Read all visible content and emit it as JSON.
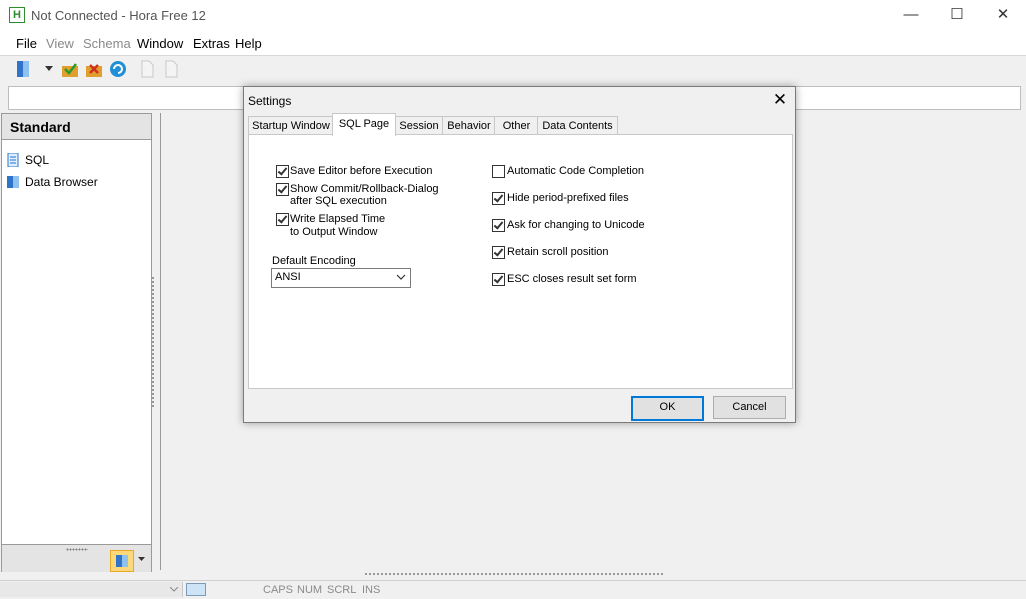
{
  "window": {
    "title": "Not Connected - Hora Free 12",
    "app_icon_letter": "H",
    "minimize": "—",
    "maximize": "☐",
    "close": "✕"
  },
  "menu": [
    "File",
    "View",
    "Schema",
    "Window",
    "Extras",
    "Help"
  ],
  "panel": {
    "title": "Standard",
    "items": [
      {
        "label": "SQL",
        "icon": "sql-page-icon"
      },
      {
        "label": "Data Browser",
        "icon": "data-browser-icon"
      }
    ]
  },
  "statusbar": [
    "CAPS",
    "NUM",
    "SCRL",
    "INS"
  ],
  "dialog": {
    "title": "Settings",
    "close": "✕",
    "tabs": [
      "Startup Window",
      "SQL Page",
      "Session",
      "Behavior",
      "Other",
      "Data Contents"
    ],
    "active_tab": "SQL Page",
    "left_checks": [
      {
        "line1": "Save Editor before Execution",
        "line2": "",
        "checked": true
      },
      {
        "line1": "Show Commit/Rollback-Dialog",
        "line2": "after SQL execution",
        "checked": true
      },
      {
        "line1": "Write Elapsed Time",
        "line2": "to Output Window",
        "checked": true
      }
    ],
    "right_checks": [
      {
        "label": "Automatic Code Completion",
        "checked": false
      },
      {
        "label": "Hide period-prefixed files",
        "checked": true
      },
      {
        "label": "Ask for changing to Unicode",
        "checked": true
      },
      {
        "label": "Retain scroll position",
        "checked": true
      },
      {
        "label": "ESC closes result set form",
        "checked": true
      }
    ],
    "encoding": {
      "label": "Default Encoding",
      "value": "ANSI"
    },
    "ok": "OK",
    "cancel": "Cancel"
  },
  "colors": {
    "accent": "#0078d7",
    "disabled_text": "#8a8a8a",
    "app_icon": "#2e8b2e"
  }
}
